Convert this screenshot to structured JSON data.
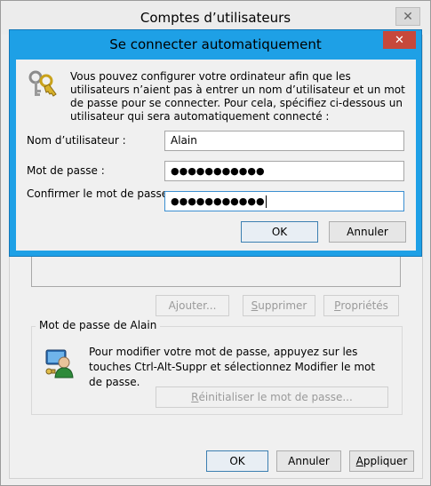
{
  "outer_window": {
    "title": "Comptes d’utilisateurs",
    "close_glyph": "✕",
    "buttons": {
      "add": {
        "pre": "A",
        "key": "j",
        "post": "outer..."
      },
      "remove": {
        "pre": "",
        "key": "S",
        "post": "upprimer"
      },
      "properties": {
        "pre": "",
        "key": "P",
        "post": "ropriétés"
      }
    },
    "password_group": {
      "legend": "Mot de passe de Alain",
      "info": "Pour modifier votre mot de passe, appuyez sur les touches Ctrl-Alt-Suppr et sélectionnez Modifier le mot de passe.",
      "reset_button": {
        "pre": "",
        "key": "R",
        "post": "éinitialiser le mot de passe..."
      }
    },
    "footer": {
      "ok": "OK",
      "cancel": "Annuler",
      "apply": {
        "pre": "",
        "key": "A",
        "post": "ppliquer"
      }
    },
    "icons": {
      "user": "user-key-icon"
    }
  },
  "dialog": {
    "title": "Se connecter automatiquement",
    "close_glyph": "✕",
    "info": "Vous pouvez configurer votre ordinateur afin que les utilisateurs n’aient pas à entrer un nom d’utilisateur et un mot de passe pour se connecter. Pour cela, spécifiez ci-dessous un utilisateur qui sera automatiquement connecté :",
    "username_label": "Nom d’utilisateur :",
    "username_value": "Alain",
    "password_label": "Mot de passe :",
    "password_value": "●●●●●●●●●●●",
    "confirm_label": "Confirmer le mot de passe :",
    "confirm_value": "●●●●●●●●●●●",
    "ok": "OK",
    "cancel": "Annuler",
    "icons": {
      "keys": "keys-icon"
    }
  },
  "colors": {
    "dialog_frame": "#1ea0e6",
    "close_button": "#c7483b",
    "window_bg": "#f0f0f0"
  }
}
